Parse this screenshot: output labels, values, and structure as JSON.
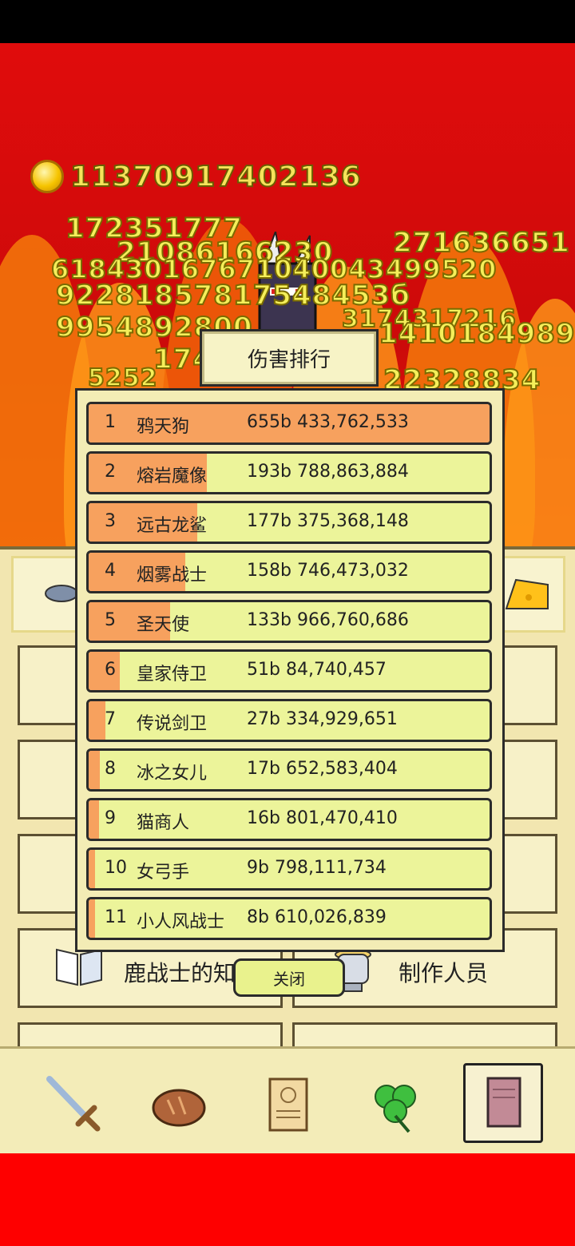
{
  "gold": "11370917402136",
  "floating_damage": [
    "172351777",
    "21086166230",
    "271636651",
    "618430167671040043499520",
    "92281857817548453б",
    "9954892800",
    "3174317216",
    "1410184989",
    "174",
    "5252",
    "22328834"
  ],
  "ranking": {
    "title": "伤害排行",
    "close_label": "关闭",
    "rows": [
      {
        "rank": "1",
        "name": "鸦天狗",
        "damage": "655b 433,762,533",
        "share": 1.0
      },
      {
        "rank": "2",
        "name": "熔岩魔像",
        "damage": "193b 788,863,884",
        "share": 0.295
      },
      {
        "rank": "3",
        "name": "远古龙鲨",
        "damage": "177b 375,368,148",
        "share": 0.27
      },
      {
        "rank": "4",
        "name": "烟雾战士",
        "damage": "158b 746,473,032",
        "share": 0.242
      },
      {
        "rank": "5",
        "name": "圣天使",
        "damage": "133b 966,760,686",
        "share": 0.204
      },
      {
        "rank": "6",
        "name": "皇家侍卫",
        "damage": "51b 84,740,457",
        "share": 0.078
      },
      {
        "rank": "7",
        "name": "传说剑卫",
        "damage": "27b 334,929,651",
        "share": 0.042
      },
      {
        "rank": "8",
        "name": "冰之女儿",
        "damage": "17b 652,583,404",
        "share": 0.027
      },
      {
        "rank": "9",
        "name": "猫商人",
        "damage": "16b 801,470,410",
        "share": 0.025
      },
      {
        "rank": "10",
        "name": "女弓手",
        "damage": "9b 798,111,734",
        "share": 0.015
      },
      {
        "rank": "11",
        "name": "小人风战士",
        "damage": "8b 610,026,839",
        "share": 0.013
      }
    ]
  },
  "menu": {
    "knowledge_label": "鹿战士的知识",
    "credits_label": "制作人员"
  },
  "nav": [
    {
      "icon": "sword-icon"
    },
    {
      "icon": "bread-icon"
    },
    {
      "icon": "scroll-icon"
    },
    {
      "icon": "clover-icon"
    },
    {
      "icon": "book-icon",
      "active": true
    }
  ]
}
